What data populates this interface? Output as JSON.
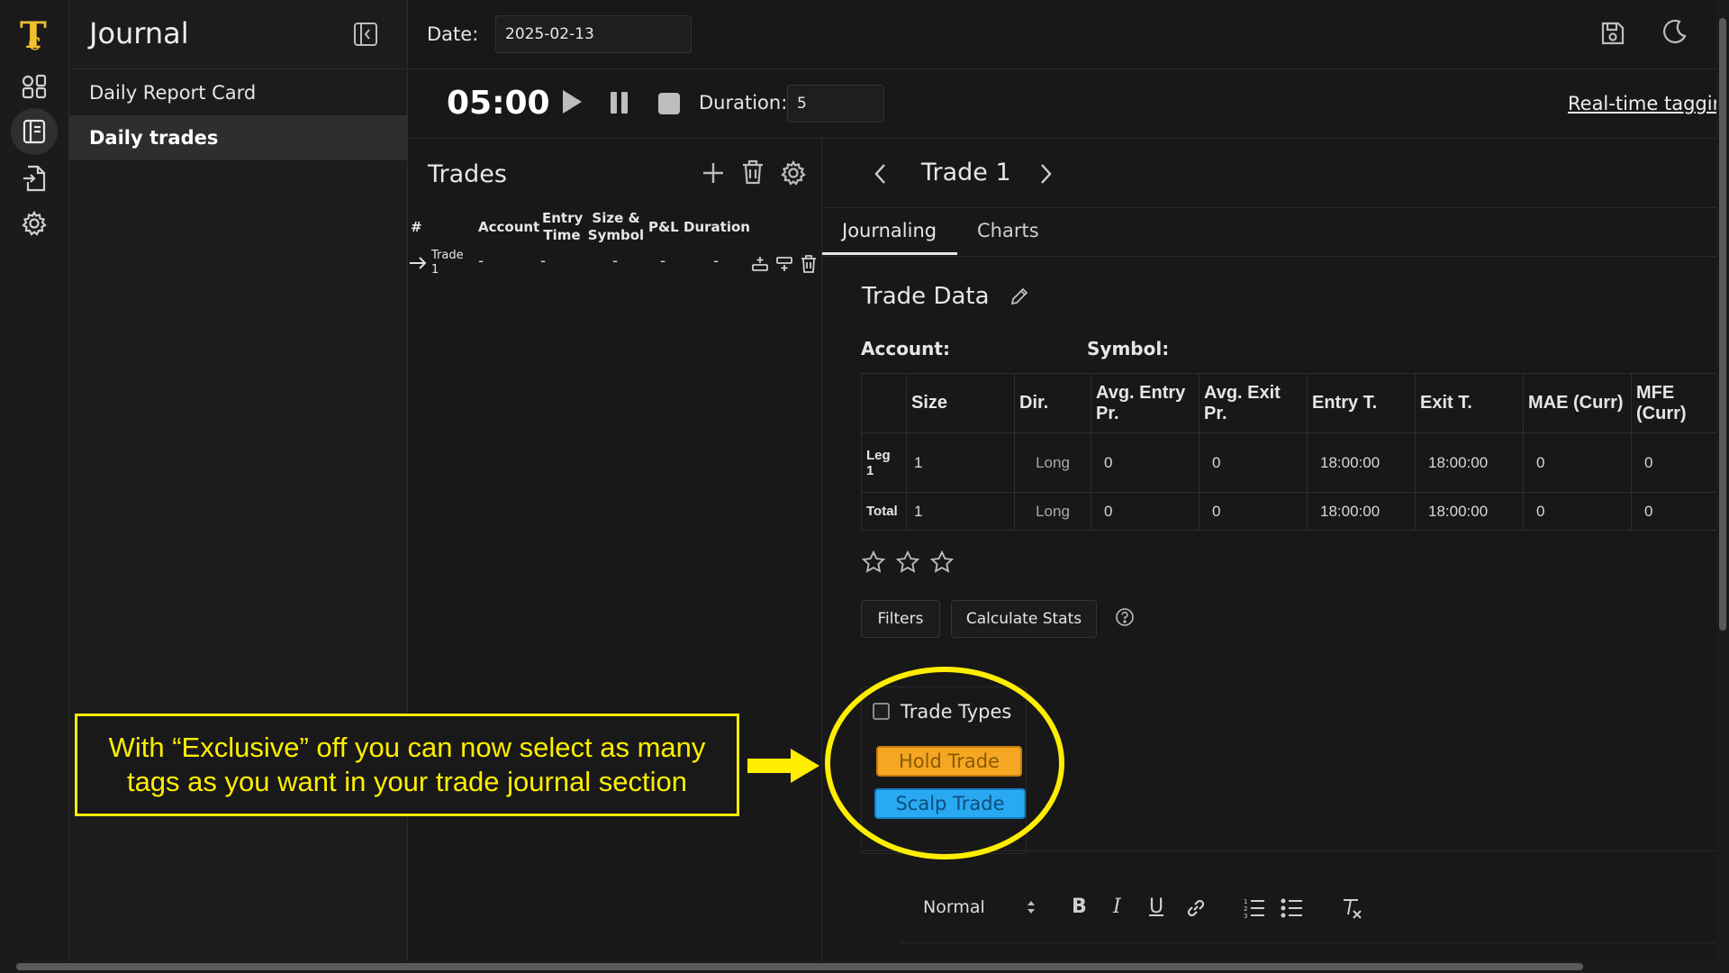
{
  "sidebar": {
    "title": "Journal",
    "items": [
      {
        "label": "Daily Report Card",
        "active": false
      },
      {
        "label": "Daily trades",
        "active": true
      }
    ]
  },
  "header": {
    "date_label": "Date:",
    "date_value": "2025-02-13"
  },
  "timer": {
    "time": "05:00",
    "duration_label": "Duration:",
    "duration_value": "5",
    "realtime_link": "Real-time taggir"
  },
  "trades_panel": {
    "title": "Trades",
    "columns": [
      "#",
      "Account",
      "Entry Time",
      "Size & Symbol",
      "P&L",
      "Duration"
    ],
    "rows": [
      {
        "num": "Trade 1",
        "account": "-",
        "entry_time": "-",
        "size_symbol": "-",
        "pnl": "-",
        "duration": "-"
      }
    ]
  },
  "trade_detail": {
    "title": "Trade 1",
    "tabs": [
      {
        "label": "Journaling",
        "active": true
      },
      {
        "label": "Charts",
        "active": false
      }
    ],
    "section_title": "Trade Data",
    "account_label": "Account:",
    "symbol_label": "Symbol:",
    "legs_table": {
      "columns": [
        "",
        "Size",
        "Dir.",
        "Avg. Entry Pr.",
        "Avg. Exit Pr.",
        "Entry T.",
        "Exit T.",
        "MAE (Curr)",
        "MFE (Curr)"
      ],
      "rows": [
        [
          "Leg 1",
          "1",
          "Long",
          "0",
          "0",
          "18:00:00",
          "18:00:00",
          "0",
          "0"
        ],
        [
          "Total",
          "1",
          "Long",
          "0",
          "0",
          "18:00:00",
          "18:00:00",
          "0",
          "0"
        ]
      ]
    },
    "rating": {
      "value": 0,
      "max": 3
    },
    "filters_button": "Filters",
    "calc_button": "Calculate Stats",
    "trade_types": {
      "label": "Trade Types",
      "checked": false,
      "tags": [
        {
          "label": "Hold Trade",
          "color": "#f5a623"
        },
        {
          "label": "Scalp Trade",
          "color": "#29a9f2"
        }
      ]
    },
    "editor": {
      "format_select": "Normal"
    }
  },
  "annotation": {
    "text": "With “Exclusive” off you can now select as many tags as you want in your trade journal section",
    "color": "#ffee00"
  }
}
